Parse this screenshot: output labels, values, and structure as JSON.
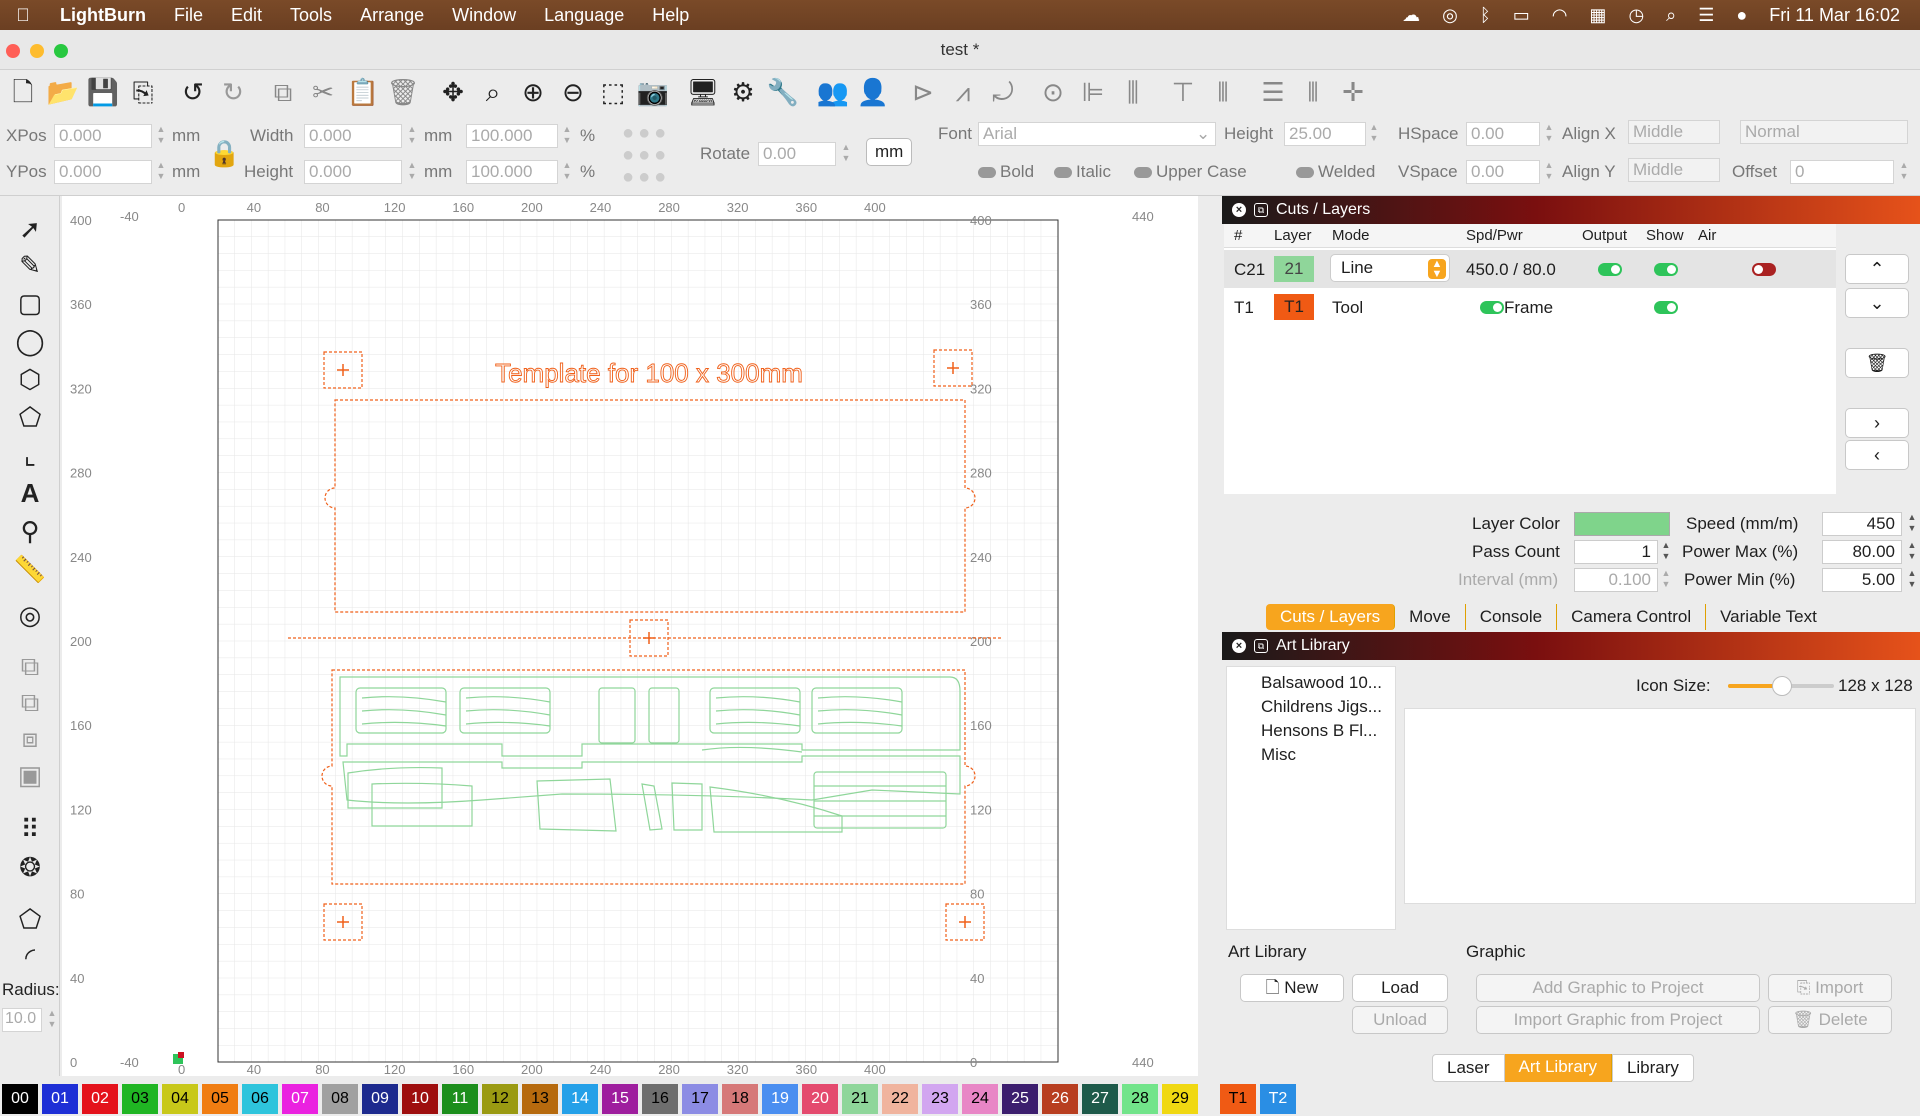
{
  "menubar": {
    "app": "LightBurn",
    "items": [
      "File",
      "Edit",
      "Tools",
      "Arrange",
      "Window",
      "Language",
      "Help"
    ],
    "clock": "Fri 11 Mar  16:02"
  },
  "window": {
    "title": "test *"
  },
  "props": {
    "xpos_label": "XPos",
    "xpos": "0.000",
    "ypos_label": "YPos",
    "ypos": "0.000",
    "unit": "mm",
    "width_label": "Width",
    "width": "0.000",
    "height_label": "Height",
    "height": "0.000",
    "wpct": "100.000",
    "hpct": "100.000",
    "pct": "%",
    "rotate_label": "Rotate",
    "rotate": "0.00",
    "mm_btn": "mm",
    "font_label": "Font",
    "font": "Arial",
    "fheight_label": "Height",
    "fheight": "25.00",
    "hspace_label": "HSpace",
    "hspace": "0.00",
    "vspace_label": "VSpace",
    "vspace": "0.00",
    "alignx_label": "Align X",
    "alignx": "Middle",
    "aligny_label": "Align Y",
    "aligny": "Middle",
    "normal": "Normal",
    "offset_label": "Offset",
    "offset": "0",
    "bold": "Bold",
    "italic": "Italic",
    "upper": "Upper Case",
    "welded": "Welded"
  },
  "tools": {
    "radius_label": "Radius:",
    "radius": "10.0"
  },
  "canvas": {
    "text": "Template for 100 x 300mm",
    "yticks": [
      "400",
      "360",
      "320",
      "280",
      "240",
      "200",
      "160",
      "120",
      "80",
      "40",
      "0"
    ],
    "xticks": [
      "0",
      "40",
      "80",
      "120",
      "160",
      "200",
      "240",
      "280",
      "320",
      "360",
      "400"
    ],
    "xneg": "-40",
    "xpos": "440"
  },
  "cuts": {
    "title": "Cuts / Layers",
    "headers": [
      "#",
      "Layer",
      "Mode",
      "Spd/Pwr",
      "Output",
      "Show",
      "Air"
    ],
    "rows": [
      {
        "id": "C21",
        "layer": "21",
        "mode": "Line",
        "spdpwr": "450.0 / 80.0",
        "layer_color": "#8fd69a"
      },
      {
        "id": "T1",
        "layer": "T1",
        "mode": "Tool",
        "spdpwr": "Frame",
        "layer_color": "#f05a14"
      }
    ],
    "layer_color_label": "Layer Color",
    "pass_label": "Pass Count",
    "pass": "1",
    "interval_label": "Interval (mm)",
    "interval": "0.100",
    "speed_label": "Speed (mm/m)",
    "speed": "450",
    "pmax_label": "Power Max (%)",
    "pmax": "80.00",
    "pmin_label": "Power Min (%)",
    "pmin": "5.00",
    "swatch": "#7fd48b"
  },
  "tabs1": [
    "Cuts / Layers",
    "Move",
    "Console",
    "Camera Control",
    "Variable Text"
  ],
  "art": {
    "title": "Art Library",
    "items": [
      "Balsawood 10...",
      "Childrens Jigs...",
      "Hensons  B Fl...",
      "Misc"
    ],
    "icon_size_label": "Icon Size:",
    "icon_size": "128 x 128",
    "lib_label": "Art Library",
    "graphic_label": "Graphic",
    "new": "New",
    "load": "Load",
    "unload": "Unload",
    "add_graphic": "Add Graphic to Project",
    "import_graphic": "Import Graphic from Project",
    "import": "Import",
    "delete": "Delete"
  },
  "tabs2": [
    "Laser",
    "Art Library",
    "Library"
  ],
  "palette": [
    {
      "l": "00",
      "c": "#000000",
      "t": "#fff"
    },
    {
      "l": "01",
      "c": "#1e2fd6",
      "t": "#fff"
    },
    {
      "l": "02",
      "c": "#e4121b",
      "t": "#fff"
    },
    {
      "l": "03",
      "c": "#20b523",
      "t": "#000"
    },
    {
      "l": "04",
      "c": "#c8c81a",
      "t": "#000"
    },
    {
      "l": "05",
      "c": "#f07d12",
      "t": "#000"
    },
    {
      "l": "06",
      "c": "#2ec4dc",
      "t": "#000"
    },
    {
      "l": "07",
      "c": "#ea22e0",
      "t": "#fff"
    },
    {
      "l": "08",
      "c": "#a0a0a0",
      "t": "#000"
    },
    {
      "l": "09",
      "c": "#1d2a8e",
      "t": "#fff"
    },
    {
      "l": "10",
      "c": "#9e0e0e",
      "t": "#fff"
    },
    {
      "l": "11",
      "c": "#1c8e1c",
      "t": "#fff"
    },
    {
      "l": "12",
      "c": "#9a9a12",
      "t": "#000"
    },
    {
      "l": "13",
      "c": "#b66a0e",
      "t": "#000"
    },
    {
      "l": "14",
      "c": "#24a0e8",
      "t": "#fff"
    },
    {
      "l": "15",
      "c": "#9e1e9e",
      "t": "#fff"
    },
    {
      "l": "16",
      "c": "#6e6e6e",
      "t": "#000"
    },
    {
      "l": "17",
      "c": "#8c8ce4",
      "t": "#000"
    },
    {
      "l": "18",
      "c": "#d67878",
      "t": "#000"
    },
    {
      "l": "19",
      "c": "#4a8ef0",
      "t": "#fff"
    },
    {
      "l": "20",
      "c": "#e44a6e",
      "t": "#fff"
    },
    {
      "l": "21",
      "c": "#8fd69a",
      "t": "#000"
    },
    {
      "l": "22",
      "c": "#f0b49e",
      "t": "#000"
    },
    {
      "l": "23",
      "c": "#d2a6f0",
      "t": "#000"
    },
    {
      "l": "24",
      "c": "#e886c6",
      "t": "#000"
    },
    {
      "l": "25",
      "c": "#3c1e6e",
      "t": "#fff"
    },
    {
      "l": "26",
      "c": "#b83e20",
      "t": "#fff"
    },
    {
      "l": "27",
      "c": "#1e5a4a",
      "t": "#fff"
    },
    {
      "l": "28",
      "c": "#72e48a",
      "t": "#000"
    },
    {
      "l": "29",
      "c": "#f0d812",
      "t": "#000"
    },
    {
      "l": "T1",
      "c": "#f05a14",
      "t": "#000"
    },
    {
      "l": "T2",
      "c": "#2a8ee4",
      "t": "#fff"
    }
  ]
}
